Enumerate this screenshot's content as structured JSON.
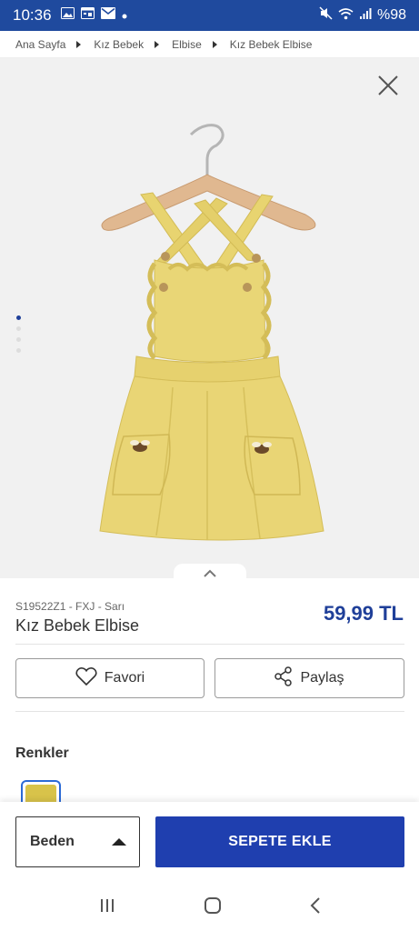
{
  "status_bar": {
    "time": "10:36",
    "battery": "%98",
    "icons": [
      "image-icon",
      "calendar-icon",
      "mail-icon",
      "dot-icon",
      "mute-icon",
      "wifi-icon",
      "signal-icon"
    ]
  },
  "breadcrumb": [
    "Ana Sayfa",
    "Kız Bebek",
    "Elbise",
    "Kız Bebek Elbise"
  ],
  "gallery": {
    "image_count": 4,
    "active_index": 0,
    "image_alt": "Kız Bebek Elbise"
  },
  "product": {
    "code": "S19522Z1 - FXJ - Sarı",
    "name": "Kız Bebek Elbise",
    "price": "59,99 TL"
  },
  "actions": {
    "favorite_label": "Favori",
    "share_label": "Paylaş"
  },
  "colors": {
    "title": "Renkler",
    "swatches": [
      "#d8c34a"
    ]
  },
  "bottom": {
    "size_label": "Beden",
    "add_to_cart_label": "SEPETE EKLE"
  },
  "theme": {
    "primary": "#1f3faf",
    "status_bar": "#1f4a9e",
    "price": "#1f3f99"
  }
}
